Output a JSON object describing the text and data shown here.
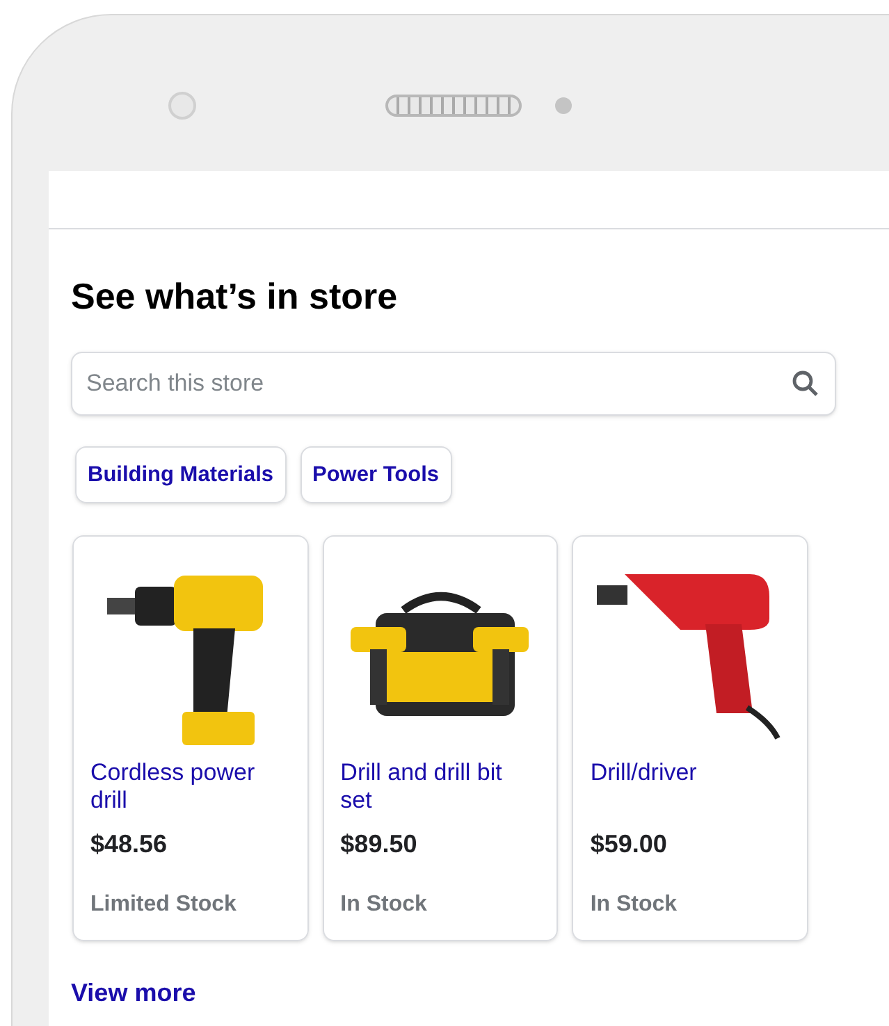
{
  "heading": "See what’s in store",
  "search": {
    "placeholder": "Search this store"
  },
  "chips": [
    {
      "label": "Building Materials"
    },
    {
      "label": "Power Tools"
    }
  ],
  "products": [
    {
      "name": "Cordless power drill",
      "price": "$48.56",
      "stock": "Limited Stock"
    },
    {
      "name": "Drill and drill bit set",
      "price": "$89.50",
      "stock": "In Stock"
    },
    {
      "name": "Drill/driver",
      "price": "$59.00",
      "stock": "In Stock"
    }
  ],
  "link": "View more"
}
